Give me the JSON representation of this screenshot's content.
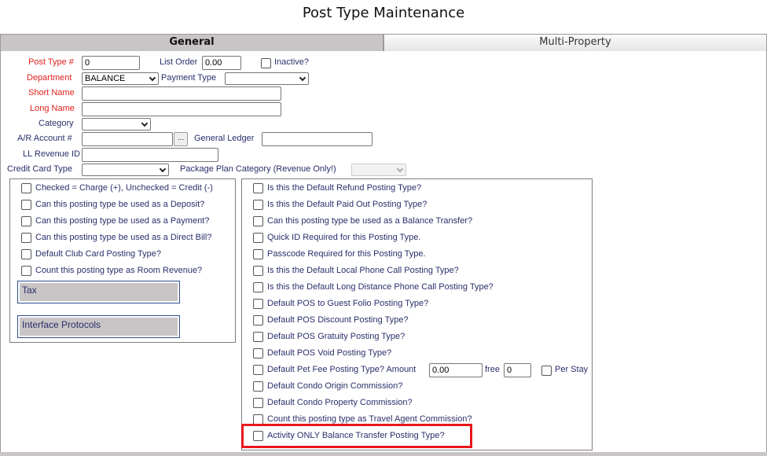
{
  "title": "Post Type Maintenance",
  "tabs": {
    "general": "General",
    "multi_property": "Multi-Property"
  },
  "form": {
    "post_type_label": "Post Type #",
    "post_type_value": "0",
    "list_order_label": "List Order",
    "list_order_value": "0.00",
    "inactive_label": "Inactive?",
    "department_label": "Department",
    "department_value": "BALANCE",
    "payment_type_label": "Payment Type",
    "payment_type_value": "",
    "short_name_label": "Short Name",
    "short_name_value": "",
    "long_name_label": "Long Name",
    "long_name_value": "",
    "category_label": "Category",
    "category_value": "",
    "ar_account_label": "A/R Account #",
    "ar_account_value": "",
    "browse_label": "...",
    "general_ledger_label": "General Ledger",
    "general_ledger_value": "",
    "ll_revenue_label": "LL Revenue ID",
    "ll_revenue_value": "",
    "credit_card_type_label": "Credit Card Type",
    "credit_card_type_value": "",
    "package_plan_label": "Package Plan Category (Revenue Only!)",
    "package_plan_value": ""
  },
  "left_panel": {
    "checks": [
      "Checked = Charge (+), Unchecked = Credit (-)",
      "Can this posting type be used as a Deposit?",
      "Can this posting type be used as a Payment?",
      "Can this posting type be used as a Direct Bill?",
      "Default Club Card Posting Type?",
      "Count this posting type as Room Revenue?"
    ],
    "tax_label": "Tax",
    "interface_label": "Interface Protocols"
  },
  "right_panel": {
    "checks": [
      "Is this the Default Refund Posting Type?",
      "Is this the Default Paid Out Posting Type?",
      "Can this posting type be used as a Balance Transfer?",
      "Quick ID Required for this Posting Type.",
      "Passcode Required for this Posting Type.",
      "Is this the Default Local Phone Call Posting Type?",
      "Is this the Default Long Distance Phone Call Posting Type?",
      "Default POS to Guest Folio Posting Type?",
      "Default POS Discount Posting Type?",
      "Default POS Gratuity Posting Type?",
      "Default POS Void Posting Type?",
      "Default Pet Fee Posting Type? Amount",
      "Default Condo Origin Commission?",
      "Default Condo Property Commission?",
      "Count this posting type as Travel Agent Commission?",
      "Activity ONLY Balance Transfer Posting Type?"
    ],
    "pet_amount_value": "0.00",
    "free_label": "free",
    "free_value": "0",
    "per_stay_label": "Per Stay"
  }
}
